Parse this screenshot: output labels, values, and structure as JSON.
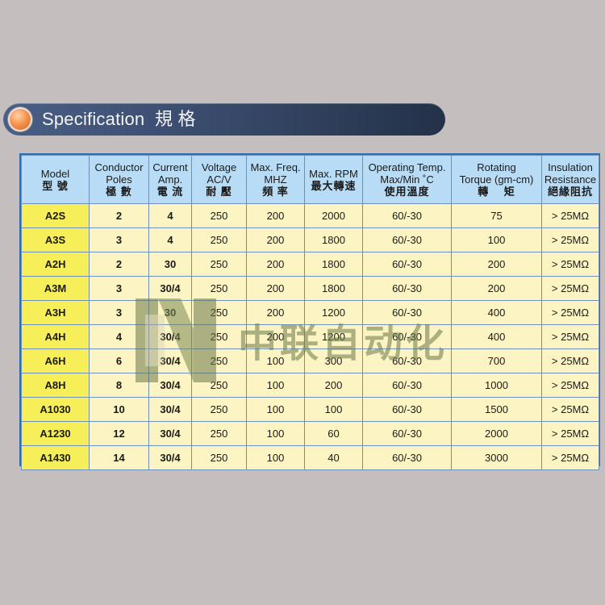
{
  "header": {
    "title": "Specification  規 格",
    "colors": {
      "bar": "#3a4c6d",
      "icon": "#f58f4a"
    }
  },
  "table": {
    "columns": [
      {
        "en": "Model",
        "cn": "型 號"
      },
      {
        "en": "Conductor\nPoles",
        "cn": "極 數"
      },
      {
        "en": "Current\nAmp.",
        "cn": "電 流"
      },
      {
        "en": "Voltage\nAC/V",
        "cn": "耐 壓"
      },
      {
        "en": "Max. Freq.\nMHZ",
        "cn": "頻 率"
      },
      {
        "en": "Max. RPM",
        "cn": "最大轉速"
      },
      {
        "en": "Operating Temp.\nMax/Min ˚C",
        "cn": "使用溫度"
      },
      {
        "en": "Rotating\nTorque (gm-cm)",
        "cn": "轉    矩"
      },
      {
        "en": "Insulation\nResistance",
        "cn": "絕緣阻抗"
      }
    ],
    "rows": [
      [
        "A2S",
        "2",
        "4",
        "250",
        "200",
        "2000",
        "60/-30",
        "75",
        "> 25MΩ"
      ],
      [
        "A3S",
        "3",
        "4",
        "250",
        "200",
        "1800",
        "60/-30",
        "100",
        "> 25MΩ"
      ],
      [
        "A2H",
        "2",
        "30",
        "250",
        "200",
        "1800",
        "60/-30",
        "200",
        "> 25MΩ"
      ],
      [
        "A3M",
        "3",
        "30/4",
        "250",
        "200",
        "1800",
        "60/-30",
        "200",
        "> 25MΩ"
      ],
      [
        "A3H",
        "3",
        "30",
        "250",
        "200",
        "1200",
        "60/-30",
        "400",
        "> 25MΩ"
      ],
      [
        "A4H",
        "4",
        "30/4",
        "250",
        "200",
        "1200",
        "60/-30",
        "400",
        "> 25MΩ"
      ],
      [
        "A6H",
        "6",
        "30/4",
        "250",
        "100",
        "300",
        "60/-30",
        "700",
        "> 25MΩ"
      ],
      [
        "A8H",
        "8",
        "30/4",
        "250",
        "100",
        "200",
        "60/-30",
        "1000",
        "> 25MΩ"
      ],
      [
        "A1030",
        "10",
        "30/4",
        "250",
        "100",
        "100",
        "60/-30",
        "1500",
        "> 25MΩ"
      ],
      [
        "A1230",
        "12",
        "30/4",
        "250",
        "100",
        "60",
        "60/-30",
        "2000",
        "> 25MΩ"
      ],
      [
        "A1430",
        "14",
        "30/4",
        "250",
        "100",
        "40",
        "60/-30",
        "3000",
        "> 25MΩ"
      ]
    ],
    "colors": {
      "header_bg": "#b9dcf6",
      "cell_bg": "#fdf4c3",
      "model_bg": "#f6ef5a",
      "border": "#2f6fb0"
    }
  },
  "watermark": {
    "text": "中联自动化",
    "icon": "n-logo-icon"
  }
}
